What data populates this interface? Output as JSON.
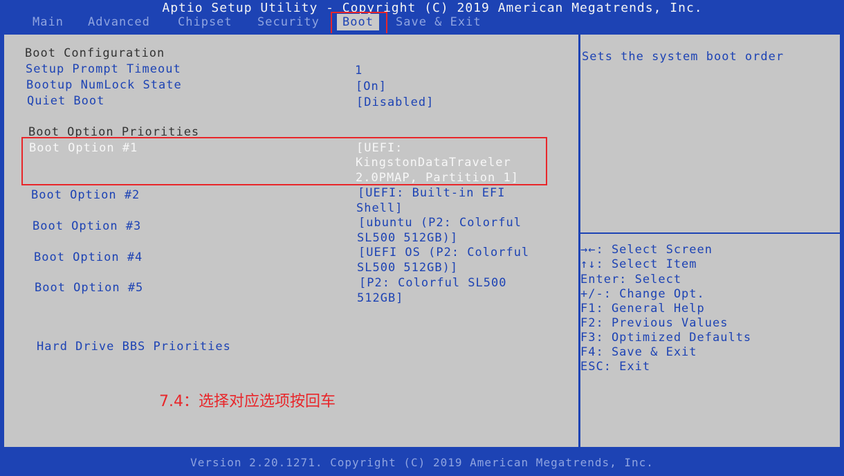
{
  "title": "Aptio Setup Utility - Copyright (C) 2019 American Megatrends, Inc.",
  "tabs": [
    "Main",
    "Advanced",
    "Chipset",
    "Security",
    "Boot",
    "Save & Exit"
  ],
  "active_tab": "Boot",
  "main": {
    "boot_configuration_heading": "Boot Configuration",
    "setup_prompt_timeout": {
      "label": "Setup Prompt Timeout",
      "value": "1"
    },
    "bootup_numlock_state": {
      "label": "Bootup NumLock State",
      "value": "[On]"
    },
    "quiet_boot": {
      "label": "Quiet Boot",
      "value": "[Disabled]"
    },
    "boot_option_priorities_heading": "Boot Option Priorities",
    "boot_options": [
      {
        "label": "Boot Option #1",
        "value_lines": [
          "[UEFI:",
          "KingstonDataTraveler",
          "2.0PMAP, Partition 1]"
        ]
      },
      {
        "label": "Boot Option #2",
        "value_lines": [
          "[UEFI: Built-in EFI",
          "Shell]"
        ]
      },
      {
        "label": "Boot Option #3",
        "value_lines": [
          "[ubuntu (P2: Colorful",
          "SL500 512GB)]"
        ]
      },
      {
        "label": "Boot Option #4",
        "value_lines": [
          "[UEFI OS (P2: Colorful",
          "SL500 512GB)]"
        ]
      },
      {
        "label": "Boot Option #5",
        "value_lines": [
          "[P2: Colorful SL500",
          "512GB]"
        ]
      }
    ],
    "hard_drive_bbs": "Hard Drive BBS Priorities"
  },
  "help": {
    "description": "Sets the system boot order",
    "keys": [
      "→←: Select Screen",
      "↑↓: Select Item",
      "Enter: Select",
      "+/-: Change Opt.",
      "F1: General Help",
      "F2: Previous Values",
      "F3: Optimized Defaults",
      "F4: Save & Exit",
      "ESC: Exit"
    ]
  },
  "annotation": "7.4：选择对应选项按回车",
  "footer": "Version 2.20.1271. Copyright (C) 2019 American Megatrends, Inc.",
  "colors": {
    "background": "#1d43b4",
    "panel": "#c6c6c6",
    "highlight": "#e8262a"
  }
}
